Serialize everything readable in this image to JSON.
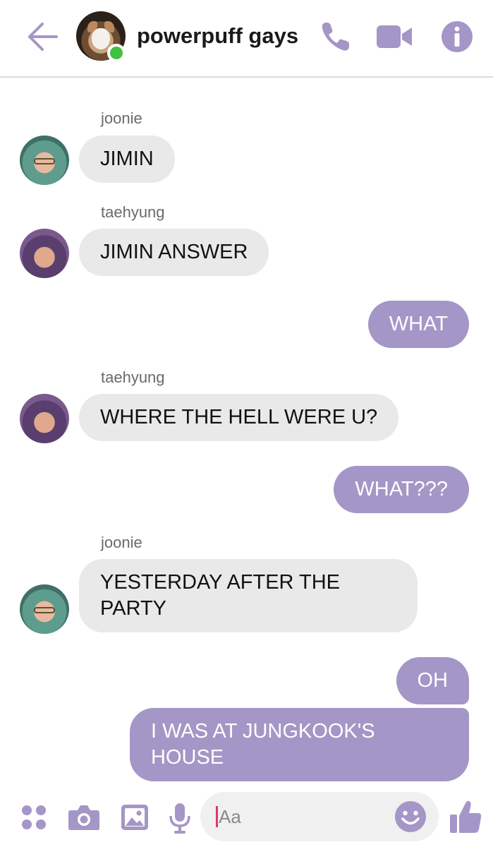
{
  "header": {
    "title": "powerpuff gays",
    "colors": {
      "accent": "#a496c6",
      "online": "#44c041"
    }
  },
  "messages": [
    {
      "sender": "joonie",
      "text": [
        "JIMIN"
      ],
      "direction": "incoming"
    },
    {
      "sender": "taehyung",
      "text": [
        "JIMIN ANSWER"
      ],
      "direction": "incoming"
    },
    {
      "sender": "",
      "text": [
        "WHAT"
      ],
      "direction": "outgoing"
    },
    {
      "sender": "taehyung",
      "text": [
        "WHERE THE HELL WERE U?"
      ],
      "direction": "incoming"
    },
    {
      "sender": "",
      "text": [
        "WHAT???"
      ],
      "direction": "outgoing"
    },
    {
      "sender": "joonie",
      "text": [
        "YESTERDAY AFTER THE",
        "PARTY"
      ],
      "direction": "incoming"
    },
    {
      "sender": "",
      "text": [
        "OH"
      ],
      "direction": "outgoing"
    },
    {
      "sender": "",
      "text": [
        "I WAS AT JUNGKOOK'S",
        "HOUSE"
      ],
      "direction": "outgoing"
    }
  ],
  "composer": {
    "placeholder": "Aa"
  },
  "icons": {
    "header": [
      "back-arrow-icon",
      "phone-icon",
      "video-camera-icon",
      "info-icon"
    ],
    "bottom": [
      "apps-grid-icon",
      "camera-icon",
      "image-icon",
      "microphone-icon",
      "emoji-icon",
      "thumbs-up-icon"
    ]
  },
  "colors": {
    "incoming_bubble": "#e9e9e9",
    "outgoing_bubble": "#a496c6",
    "cursor": "#e0356e"
  }
}
